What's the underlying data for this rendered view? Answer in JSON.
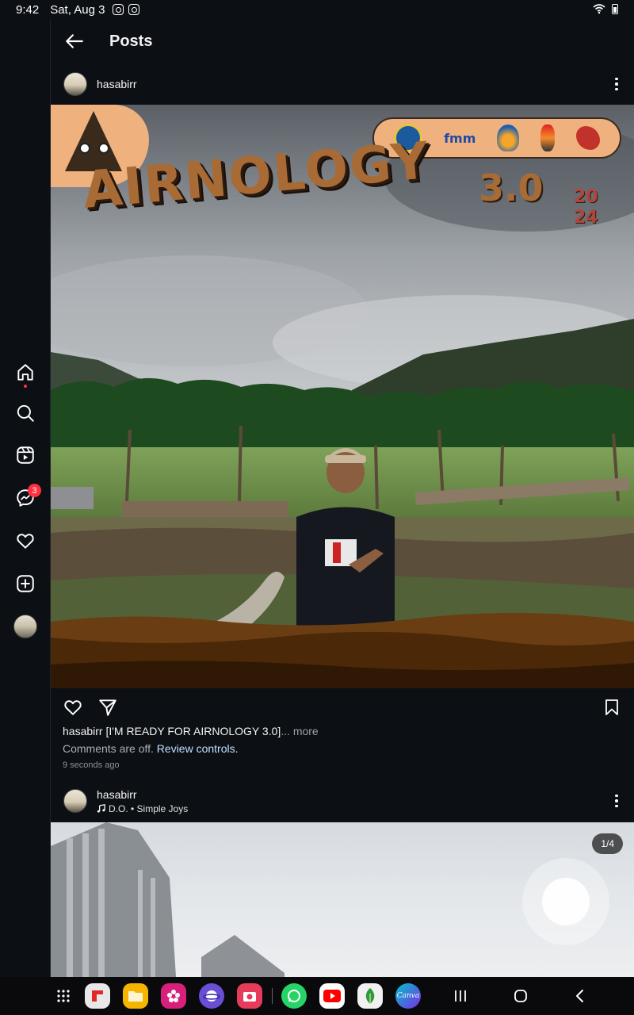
{
  "status": {
    "time": "9:42",
    "date": "Sat, Aug 3"
  },
  "header": {
    "title": "Posts"
  },
  "rail": {
    "messages_badge": "3"
  },
  "post1": {
    "username": "hasabirr",
    "image": {
      "title": "AIRNOLOGY",
      "version": "3.0",
      "year": "20 24",
      "sponsor_text": "fmm"
    },
    "caption_user": "hasabirr",
    "caption_text": "[I'M READY FOR AIRNOLOGY 3.0]",
    "caption_more": "... more",
    "comments_off": "Comments are off.",
    "review_controls": "Review controls.",
    "timestamp": "9 seconds ago"
  },
  "post2": {
    "username": "hasabirr",
    "music": "D.O. • Simple Joys",
    "counter": "1/4"
  },
  "apps": {
    "canva_label": "Canva"
  },
  "colors": {
    "background": "#0c0f14",
    "badge": "#ff3040",
    "link": "#bfe0ff",
    "accent_brown": "#a86b36"
  },
  "icons": {
    "rail": [
      "home-icon",
      "search-icon",
      "reels-icon",
      "messenger-icon",
      "heart-icon",
      "create-icon"
    ],
    "actions": [
      "heart-icon",
      "share-icon",
      "bookmark-icon"
    ]
  }
}
